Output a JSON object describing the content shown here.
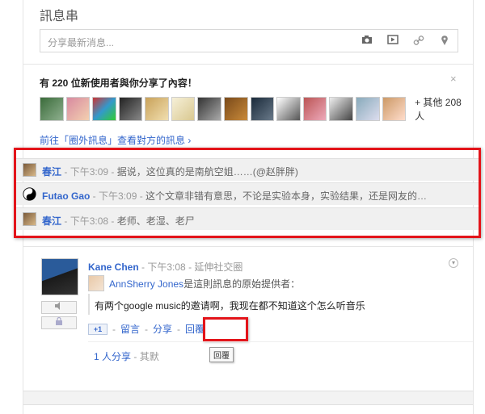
{
  "stream": {
    "title": "訊息串",
    "share_placeholder": "分享最新消息...",
    "share_icons": [
      "camera-icon",
      "video-icon",
      "link-icon",
      "location-pin-icon"
    ]
  },
  "notice": {
    "text": "有 220 位新使用者與你分享了內容！",
    "others": "+ 其他 208 人",
    "goto_link": "前往「圈外訊息」查看對方的訊息 ›",
    "close": "×"
  },
  "comments": [
    {
      "name": "春江",
      "sep": " - ",
      "time": "下午3:09",
      "text": "据说，这位真的是南航空姐……(@赵胖胖)"
    },
    {
      "name": "Futao Gao",
      "sep": " - ",
      "time": "下午3:09",
      "text": "这个文章非错有意思，不论是实验本身，实验结果，还是网友的…"
    },
    {
      "name": "春江",
      "sep": " - ",
      "time": "下午3:08",
      "text": "老师、老湿、老尸"
    }
  ],
  "post": {
    "author": "Kane Chen",
    "time": "下午3:08",
    "circle": "延伸社交圈",
    "orig_author": "AnnSherry Jones",
    "orig_suffix": "是這則訊息的原始提供者：",
    "content": "有两个google music的邀请啊，我现在都不知道这个怎么听音乐",
    "plus_one": "+1",
    "comment_label": "留言",
    "share_label": "分享",
    "reply_label": "回覆",
    "tooltip": "回覆",
    "shares_link": "1 人分享",
    "shares_suffix": "其默"
  },
  "colors": {
    "accent": "#3366cc",
    "highlight": "#e3141a"
  }
}
